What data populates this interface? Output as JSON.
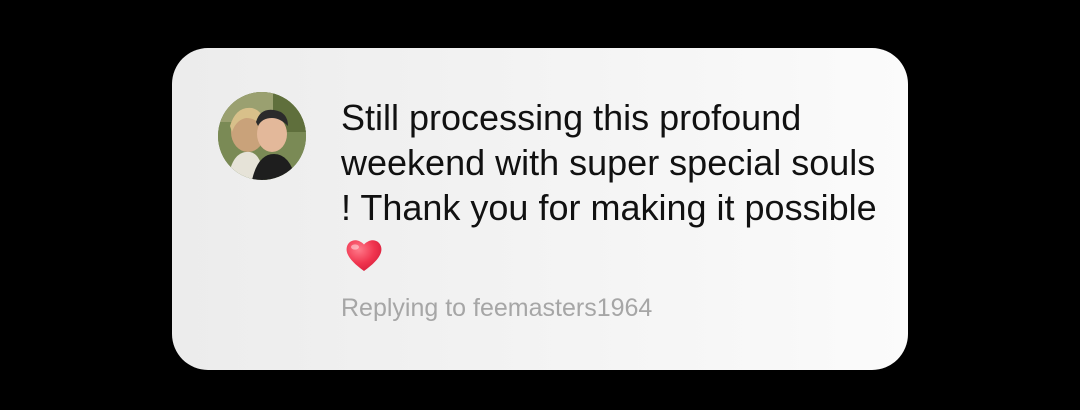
{
  "comment": {
    "text": "Still processing this profound weekend with super special souls !  Thank you for making it possible",
    "emoji": "red-heart-icon",
    "reply_prefix": "Replying to",
    "reply_username": "feemasters1964"
  },
  "colors": {
    "background": "#000000",
    "card": "#f2f2f2",
    "text": "#111111",
    "secondary_text": "#a6a6a6",
    "heart": "#f0354f"
  }
}
